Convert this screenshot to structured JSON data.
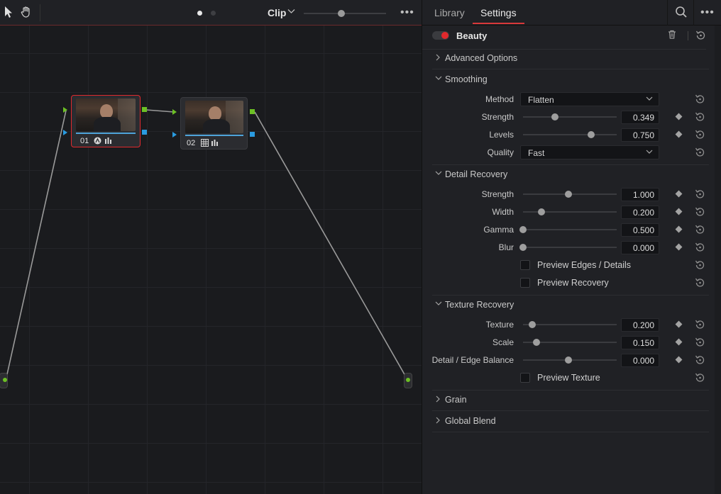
{
  "node_editor": {
    "mode_label": "Clip",
    "nodes": [
      {
        "number": "01"
      },
      {
        "number": "02"
      }
    ]
  },
  "inspector": {
    "tabs": [
      "Library",
      "Settings"
    ],
    "active_tab": "Settings",
    "effect_title": "Beauty",
    "sections": {
      "advanced_options": "Advanced Options",
      "smoothing": "Smoothing",
      "detail_recovery": "Detail Recovery",
      "texture_recovery": "Texture Recovery",
      "grain": "Grain",
      "global_blend": "Global Blend"
    },
    "smoothing": {
      "method": {
        "label": "Method",
        "value": "Flatten"
      },
      "strength": {
        "label": "Strength",
        "value": "0.349",
        "fraction": 0.349
      },
      "levels": {
        "label": "Levels",
        "value": "0.750",
        "fraction": 0.75
      },
      "quality": {
        "label": "Quality",
        "value": "Fast"
      }
    },
    "detail_recovery": {
      "strength": {
        "label": "Strength",
        "value": "1.000",
        "fraction": 0.5
      },
      "width": {
        "label": "Width",
        "value": "0.200",
        "fraction": 0.2
      },
      "gamma": {
        "label": "Gamma",
        "value": "0.500",
        "fraction": 0.0
      },
      "blur": {
        "label": "Blur",
        "value": "0.000",
        "fraction": 0.0
      },
      "preview_edges": "Preview Edges / Details",
      "preview_recovery": "Preview Recovery"
    },
    "texture_recovery": {
      "texture": {
        "label": "Texture",
        "value": "0.200",
        "fraction": 0.1
      },
      "scale": {
        "label": "Scale",
        "value": "0.150",
        "fraction": 0.15
      },
      "balance": {
        "label": "Detail / Edge Balance",
        "value": "0.000",
        "fraction": 0.5
      },
      "preview_texture": "Preview Texture"
    },
    "colors": {
      "accent": "#d8383a",
      "node_selected": "#e0292d",
      "port_green": "#6cc024",
      "port_blue": "#2a9be0"
    }
  }
}
